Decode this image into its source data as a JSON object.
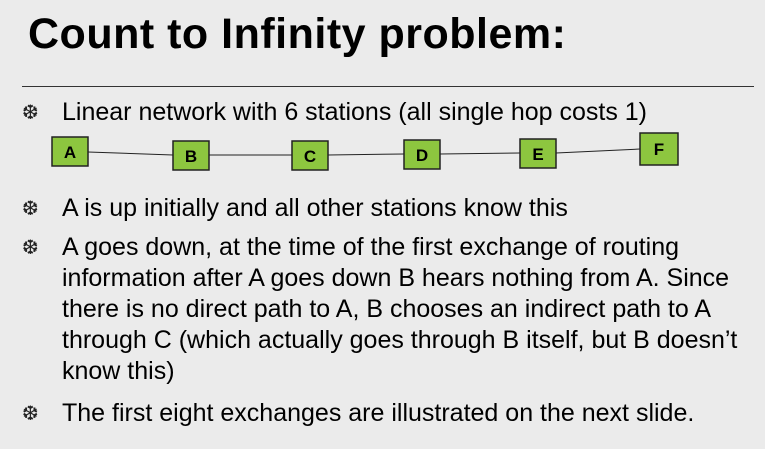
{
  "title": "Count to Infinity problem:",
  "bullets": [
    "Linear network with 6 stations (all single hop costs 1)",
    "A is up initially and all other stations know this",
    "A goes down, at the time of the first exchange of routing information after A goes down B hears nothing from A. Since there is no direct path to A, B chooses an indirect path to A through C (which actually goes through B itself, but B doesn’t know  this)",
    "The first eight exchanges are illustrated on the next slide."
  ],
  "bullet_icon": "snowflake-bullet-icon",
  "network": {
    "stations": [
      "A",
      "B",
      "C",
      "D",
      "E",
      "F"
    ],
    "link_cost": 1,
    "box_color": "#8dc63f"
  }
}
